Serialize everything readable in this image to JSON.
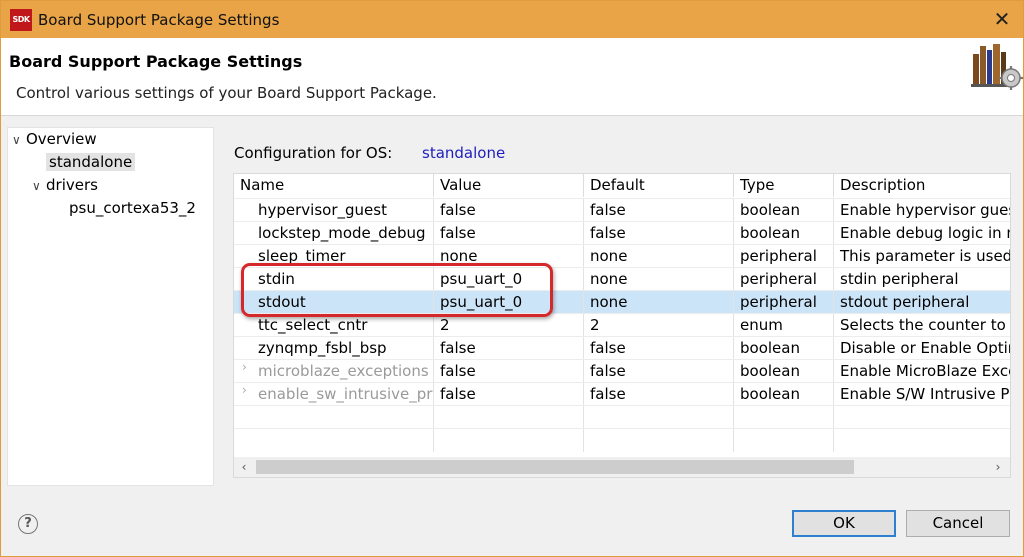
{
  "window": {
    "title": "Board Support Package Settings",
    "app_icon_text": "SDK"
  },
  "banner": {
    "title": "Board Support Package Settings",
    "description": "Control various settings of your Board Support Package."
  },
  "tree": {
    "items": [
      {
        "label": "Overview",
        "expanded": true,
        "level": 0
      },
      {
        "label": "standalone",
        "selected": true,
        "level": 1
      },
      {
        "label": "drivers",
        "expanded": true,
        "level": 1
      },
      {
        "label": "psu_cortexa53_2",
        "level": 2
      }
    ]
  },
  "config": {
    "label": "Configuration for OS:",
    "os": "standalone"
  },
  "table": {
    "headers": [
      "Name",
      "Value",
      "Default",
      "Type",
      "Description"
    ],
    "rows": [
      {
        "name": "hypervisor_guest",
        "value": "false",
        "default": "false",
        "type": "boolean",
        "description": "Enable hypervisor guest"
      },
      {
        "name": "lockstep_mode_debug",
        "value": "false",
        "default": "false",
        "type": "boolean",
        "description": "Enable debug logic in n"
      },
      {
        "name": "sleep_timer",
        "value": "none",
        "default": "none",
        "type": "peripheral",
        "description": "This parameter is used t"
      },
      {
        "name": "stdin",
        "value": "psu_uart_0",
        "default": "none",
        "type": "peripheral",
        "description": "stdin peripheral"
      },
      {
        "name": "stdout",
        "value": "psu_uart_0",
        "default": "none",
        "type": "peripheral",
        "description": "stdout peripheral"
      },
      {
        "name": "ttc_select_cntr",
        "value": "2",
        "default": "2",
        "type": "enum",
        "description": "Selects the counter to b"
      },
      {
        "name": "zynqmp_fsbl_bsp",
        "value": "false",
        "default": "false",
        "type": "boolean",
        "description": "Disable or Enable Optim"
      },
      {
        "name": "microblaze_exceptions",
        "value": "false",
        "default": "false",
        "type": "boolean",
        "description": "Enable MicroBlaze Exce"
      },
      {
        "name": "enable_sw_intrusive_pro",
        "value": "false",
        "default": "false",
        "type": "boolean",
        "description": "Enable S/W Intrusive Pro"
      }
    ],
    "selected_row": "stdout"
  },
  "buttons": {
    "ok": "OK",
    "cancel": "Cancel",
    "help": "?"
  },
  "icons": {
    "close": "close-icon",
    "expand": "chevron-down-icon",
    "collapsed": "chevron-right-icon",
    "help": "help-icon",
    "banner_art": "library-books-gear-icon"
  },
  "colors": {
    "titlebar": "#e8a446",
    "link_value": "#1e1ebd",
    "selection": "#cce4f7",
    "highlight_box": "#d4282a",
    "ok_border": "#2f7fd1"
  }
}
